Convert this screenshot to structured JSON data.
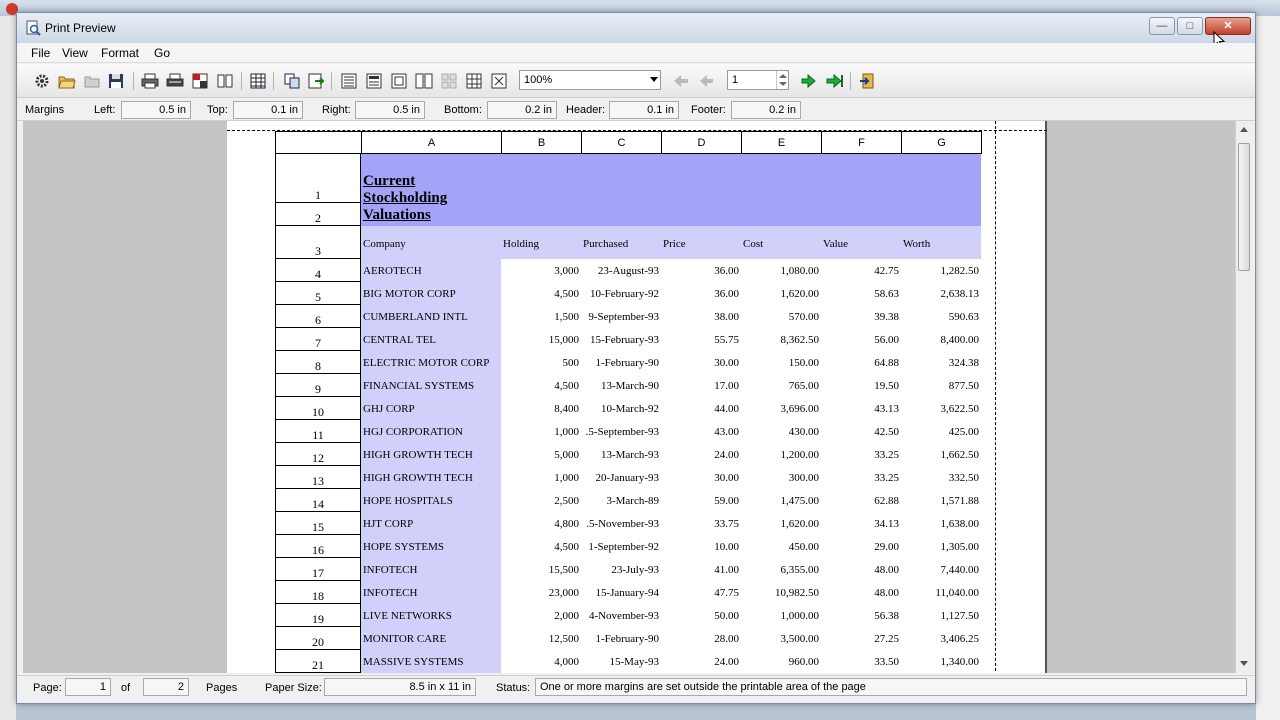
{
  "window": {
    "title": "Print Preview"
  },
  "menu": [
    "File",
    "View",
    "Format",
    "Go"
  ],
  "toolbar": {
    "zoom_value": "100%",
    "page_value": "1",
    "icons": [
      "setup-icon",
      "open-icon",
      "folder-icon",
      "save-icon",
      "print-icon",
      "print-setup-icon",
      "pdf-icon",
      "book-icon",
      "grid-icon",
      "copy-icon",
      "export-icon",
      "header-icon",
      "footer-icon",
      "page-icon",
      "two-page-icon",
      "multi-page-icon",
      "thumbnail-icon",
      "fit-icon",
      "first-page-icon",
      "prev-page-icon",
      "next-page-icon",
      "last-page-icon",
      "exit-icon"
    ]
  },
  "margins": {
    "label": "Margins",
    "left_label": "Left:",
    "left": "0.5 in",
    "top_label": "Top:",
    "top": "0.1 in",
    "right_label": "Right:",
    "right": "0.5 in",
    "bottom_label": "Bottom:",
    "bottom": "0.2 in",
    "header_label": "Header:",
    "header": "0.1 in",
    "footer_label": "Footer:",
    "footer": "0.2 in"
  },
  "sheet": {
    "columns": [
      "A",
      "B",
      "C",
      "D",
      "E",
      "F",
      "G"
    ],
    "title": "Current Stockholding Valuations",
    "headers": [
      "Company",
      "Holding",
      "Purchased",
      "Price",
      "Cost",
      "Value",
      "Worth"
    ],
    "row_numbers": [
      "1",
      "2",
      "3",
      "4",
      "5",
      "6",
      "7",
      "8",
      "9",
      "10",
      "11",
      "12",
      "13",
      "14",
      "15",
      "16",
      "17",
      "18",
      "19",
      "20",
      "21"
    ],
    "rows": [
      [
        "AEROTECH",
        "3,000",
        "23-August-93",
        "36.00",
        "1,080.00",
        "42.75",
        "1,282.50"
      ],
      [
        "BIG MOTOR CORP",
        "4,500",
        "10-February-92",
        "36.00",
        "1,620.00",
        "58.63",
        "2,638.13"
      ],
      [
        "CUMBERLAND INTL",
        "1,500",
        "9-September-93",
        "38.00",
        "570.00",
        "39.38",
        "590.63"
      ],
      [
        "CENTRAL TEL",
        "15,000",
        "15-February-93",
        "55.75",
        "8,362.50",
        "56.00",
        "8,400.00"
      ],
      [
        "ELECTRIC MOTOR CORP",
        "500",
        "1-February-90",
        "30.00",
        "150.00",
        "64.88",
        "324.38"
      ],
      [
        "FINANCIAL SYSTEMS",
        "4,500",
        "13-March-90",
        "17.00",
        "765.00",
        "19.50",
        "877.50"
      ],
      [
        "GHJ CORP",
        "8,400",
        "10-March-92",
        "44.00",
        "3,696.00",
        "43.13",
        "3,622.50"
      ],
      [
        "HGJ CORPORATION",
        "1,000",
        ".5-September-93",
        "43.00",
        "430.00",
        "42.50",
        "425.00"
      ],
      [
        "HIGH GROWTH TECH",
        "5,000",
        "13-March-93",
        "24.00",
        "1,200.00",
        "33.25",
        "1,662.50"
      ],
      [
        "HIGH GROWTH TECH",
        "1,000",
        "20-January-93",
        "30.00",
        "300.00",
        "33.25",
        "332.50"
      ],
      [
        "HOPE HOSPITALS",
        "2,500",
        "3-March-89",
        "59.00",
        "1,475.00",
        "62.88",
        "1,571.88"
      ],
      [
        "HJT CORP",
        "4,800",
        ".5-November-93",
        "33.75",
        "1,620.00",
        "34.13",
        "1,638.00"
      ],
      [
        "HOPE SYSTEMS",
        "4,500",
        "1-September-92",
        "10.00",
        "450.00",
        "29.00",
        "1,305.00"
      ],
      [
        "INFOTECH",
        "15,500",
        "23-July-93",
        "41.00",
        "6,355.00",
        "48.00",
        "7,440.00"
      ],
      [
        "INFOTECH",
        "23,000",
        "15-January-94",
        "47.75",
        "10,982.50",
        "48.00",
        "11,040.00"
      ],
      [
        "LIVE NETWORKS",
        "2,000",
        "4-November-93",
        "50.00",
        "1,000.00",
        "56.38",
        "1,127.50"
      ],
      [
        "MONITOR CARE",
        "12,500",
        "1-February-90",
        "28.00",
        "3,500.00",
        "27.25",
        "3,406.25"
      ],
      [
        "MASSIVE SYSTEMS",
        "4,000",
        "15-May-93",
        "24.00",
        "960.00",
        "33.50",
        "1,340.00"
      ]
    ]
  },
  "status": {
    "page_label": "Page:",
    "page": "1",
    "of_label": "of",
    "total": "2",
    "pages_label": "Pages",
    "paper_label": "Paper Size:",
    "paper": "8.5 in x 11 in",
    "status_label": "Status:",
    "status": "One or more margins are set outside the printable area of the page"
  },
  "colors": {
    "title_band": "#a3a3f8",
    "header_band": "#d0d0fb"
  }
}
